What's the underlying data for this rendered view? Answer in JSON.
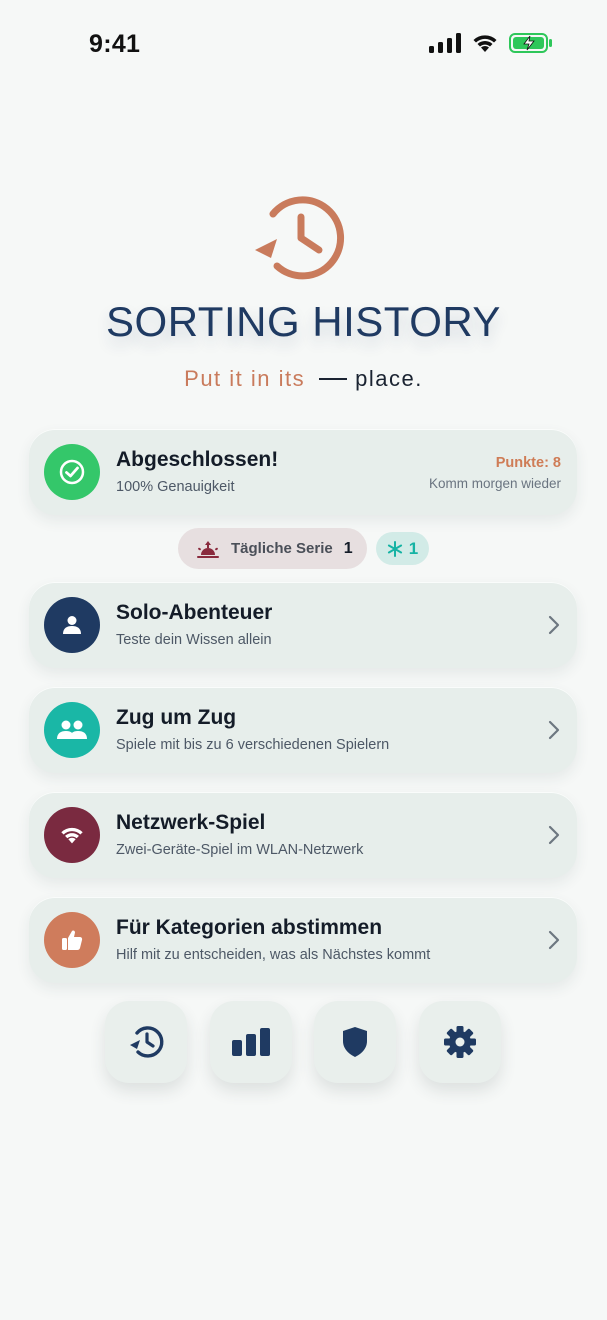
{
  "status_bar": {
    "time": "9:41"
  },
  "app": {
    "title": "SORTING HISTORY",
    "tagline_main": "Put it in its",
    "tagline_end": "place."
  },
  "daily": {
    "title": "Abgeschlossen!",
    "subtitle": "100% Genauigkeit",
    "score": "Punkte: 8",
    "note": "Komm morgen wieder"
  },
  "streak": {
    "label": "Tägliche Serie",
    "count": "1",
    "freeze_count": "1"
  },
  "menu": [
    {
      "title": "Solo-Abenteuer",
      "subtitle": "Teste dein Wissen allein",
      "icon": "person-icon",
      "color": "#1f3a62"
    },
    {
      "title": "Zug um Zug",
      "subtitle": "Spiele mit bis zu 6 verschiedenen Spielern",
      "icon": "group-icon",
      "color": "#1ab7a6"
    },
    {
      "title": "Netzwerk-Spiel",
      "subtitle": "Zwei-Geräte-Spiel im WLAN-Netzwerk",
      "icon": "wifi-icon",
      "color": "#7a2a40"
    },
    {
      "title": "Für Kategorien abstimmen",
      "subtitle": "Hilf mit zu entscheiden, was als Nächstes kommt",
      "icon": "thumbs-up-icon",
      "color": "#cf7c5c"
    }
  ],
  "bottom_nav": [
    {
      "icon": "history-icon"
    },
    {
      "icon": "bar-chart-icon"
    },
    {
      "icon": "shield-icon"
    },
    {
      "icon": "gear-icon"
    }
  ],
  "colors": {
    "accent": "#c97b5c",
    "navy": "#1f3a62",
    "success": "#34c76a",
    "teal": "#1ab7a6"
  }
}
